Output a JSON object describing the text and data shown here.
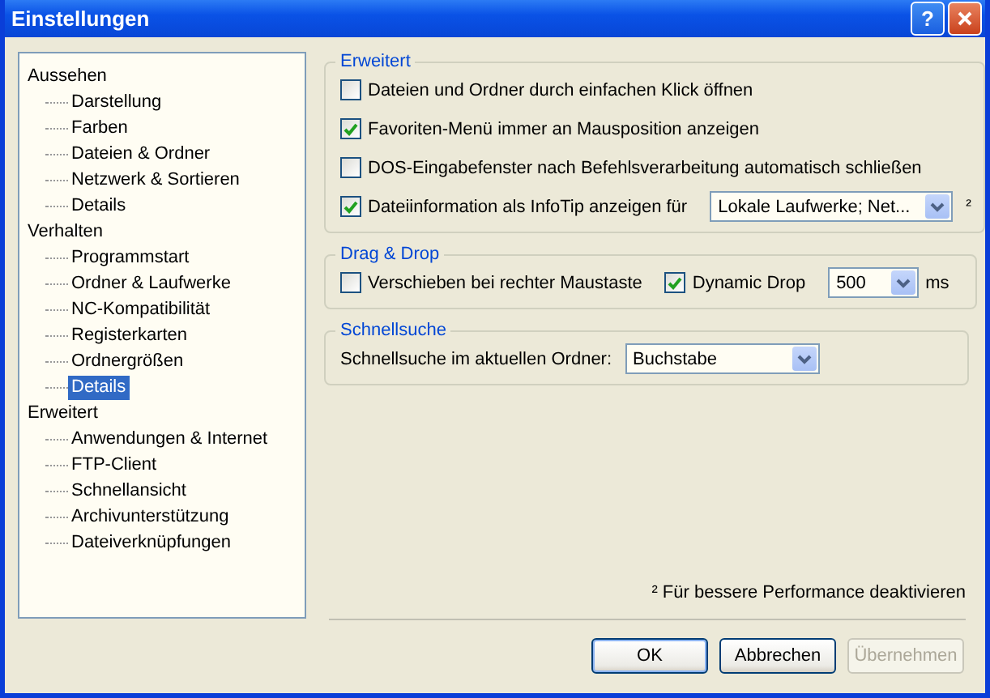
{
  "window": {
    "title": "Einstellungen",
    "help": "?"
  },
  "tree": [
    {
      "label": "Aussehen",
      "selected": false,
      "children": [
        {
          "label": "Darstellung",
          "selected": false
        },
        {
          "label": "Farben",
          "selected": false
        },
        {
          "label": "Dateien & Ordner",
          "selected": false
        },
        {
          "label": "Netzwerk & Sortieren",
          "selected": false
        },
        {
          "label": "Details",
          "selected": false
        }
      ]
    },
    {
      "label": "Verhalten",
      "selected": false,
      "children": [
        {
          "label": "Programmstart",
          "selected": false
        },
        {
          "label": "Ordner & Laufwerke",
          "selected": false
        },
        {
          "label": "NC-Kompatibilität",
          "selected": false
        },
        {
          "label": "Registerkarten",
          "selected": false
        },
        {
          "label": "Ordnergrößen",
          "selected": false
        },
        {
          "label": "Details",
          "selected": true
        }
      ]
    },
    {
      "label": "Erweitert",
      "selected": false,
      "children": [
        {
          "label": "Anwendungen & Internet",
          "selected": false
        },
        {
          "label": "FTP-Client",
          "selected": false
        },
        {
          "label": "Schnellansicht",
          "selected": false
        },
        {
          "label": "Archivunterstützung",
          "selected": false
        },
        {
          "label": "Dateiverknüpfungen",
          "selected": false
        }
      ]
    }
  ],
  "groups": [
    {
      "title": "Erweitert",
      "rows": [
        [
          {
            "kind": "checkbox",
            "label": "Dateien und Ordner durch einfachen Klick öffnen",
            "checked": false
          }
        ],
        [
          {
            "kind": "checkbox",
            "label": "Favoriten-Menü immer an Mausposition anzeigen",
            "checked": true
          }
        ],
        [
          {
            "kind": "checkbox",
            "label": "DOS-Eingabefenster nach Befehlsverarbeitung automatisch schließen",
            "checked": false
          }
        ],
        [
          {
            "kind": "checkbox",
            "label": "Dateiinformation als InfoTip anzeigen für",
            "checked": true
          },
          {
            "kind": "combo",
            "value": "Lokale Laufwerke; Net..."
          },
          {
            "kind": "note",
            "text": "²"
          }
        ]
      ]
    },
    {
      "title": "Drag & Drop",
      "rows": [
        [
          {
            "kind": "checkbox",
            "label": "Verschieben bei rechter Maustaste",
            "checked": false
          },
          {
            "kind": "checkbox",
            "label": "Dynamic Drop",
            "checked": true
          },
          {
            "kind": "combo",
            "value": "500"
          },
          {
            "kind": "label",
            "text": "ms"
          }
        ]
      ]
    },
    {
      "title": "Schnellsuche",
      "rows": [
        [
          {
            "kind": "label",
            "text": "Schnellsuche im aktuellen Ordner:"
          },
          {
            "kind": "combo",
            "value": "Buchstabe"
          }
        ]
      ]
    }
  ],
  "footnote": "² Für bessere Performance deaktivieren",
  "buttons": [
    {
      "label": "OK",
      "disabled": false,
      "default": true
    },
    {
      "label": "Abbrechen",
      "disabled": false,
      "default": false
    },
    {
      "label": "Übernehmen",
      "disabled": true,
      "default": false
    }
  ]
}
